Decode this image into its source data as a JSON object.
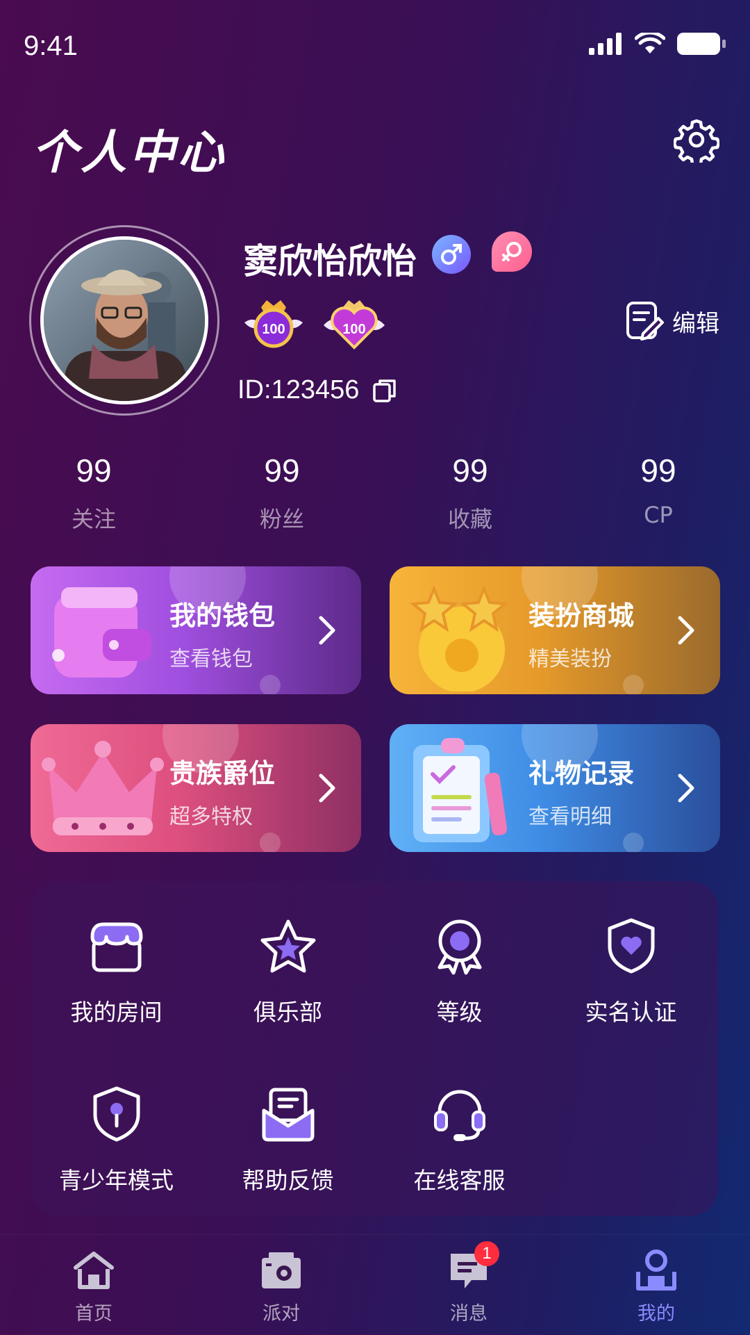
{
  "status_bar": {
    "time": "9:41"
  },
  "header": {
    "title": "个人中心"
  },
  "profile": {
    "name": "窦欣怡欣怡",
    "id": "ID:123456",
    "edit_label": "编辑",
    "level_badges": [
      "100",
      "100"
    ]
  },
  "stats": [
    {
      "value": "99",
      "label": "关注"
    },
    {
      "value": "99",
      "label": "粉丝"
    },
    {
      "value": "99",
      "label": "收藏"
    },
    {
      "value": "99",
      "label": "CP"
    }
  ],
  "cards": [
    {
      "title": "我的钱包",
      "subtitle": "查看钱包",
      "color": "#a64be8"
    },
    {
      "title": "装扮商城",
      "subtitle": "精美装扮",
      "color": "#e8a531"
    },
    {
      "title": "贵族爵位",
      "subtitle": "超多特权",
      "color": "#ee5582"
    },
    {
      "title": "礼物记录",
      "subtitle": "查看明细",
      "color": "#3c8ff0"
    }
  ],
  "features": [
    {
      "label": "我的房间",
      "icon": "store-icon"
    },
    {
      "label": "俱乐部",
      "icon": "star-icon"
    },
    {
      "label": "等级",
      "icon": "medal-icon"
    },
    {
      "label": "实名认证",
      "icon": "shield-heart-icon"
    },
    {
      "label": "青少年模式",
      "icon": "shield-key-icon"
    },
    {
      "label": "帮助反馈",
      "icon": "mail-icon"
    },
    {
      "label": "在线客服",
      "icon": "headset-icon"
    }
  ],
  "tabbar": {
    "items": [
      {
        "label": "首页",
        "icon": "home-icon"
      },
      {
        "label": "派对",
        "icon": "party-icon"
      },
      {
        "label": "消息",
        "icon": "message-icon",
        "badge": "1"
      },
      {
        "label": "我的",
        "icon": "profile-icon"
      }
    ],
    "active_index": 3,
    "accent": "#8a8bff"
  }
}
